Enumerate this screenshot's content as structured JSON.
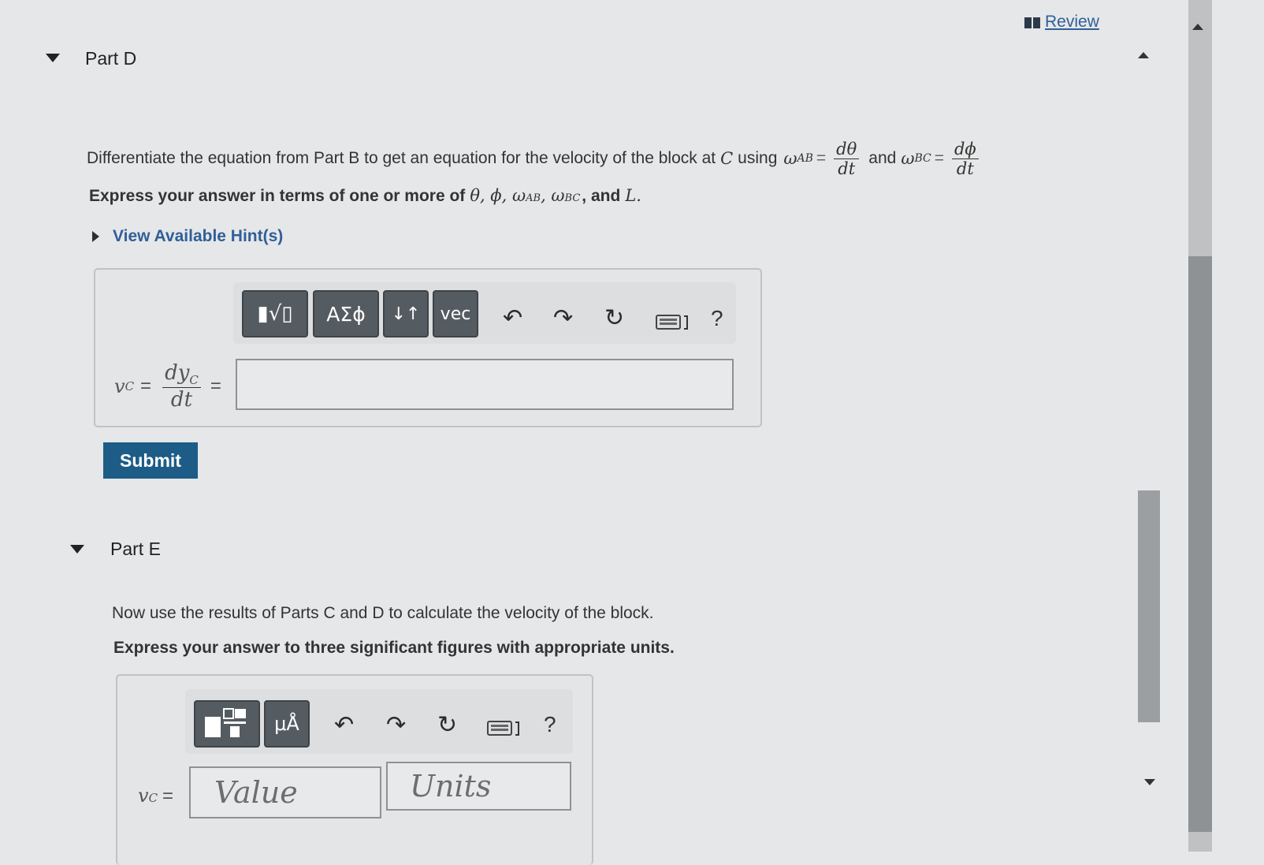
{
  "header": {
    "review_label": "Review"
  },
  "part_d": {
    "title": "Part D",
    "question_text": "Differentiate the equation from Part B to get an equation for the velocity of the block at",
    "point_c": "C",
    "using": "using",
    "omega_ab": "ω",
    "ab_sub": "AB",
    "equals": "=",
    "dtheta": "dθ",
    "dt": "dt",
    "and": "and",
    "omega_bc": "ω",
    "bc_sub": "BC",
    "dphi": "dϕ",
    "instruction_text": "Express your answer in terms of one or more of",
    "vars": "θ, ϕ, ω",
    "vars_ab": "AB",
    "vars_comma": ", ω",
    "vars_bc": "BC",
    "vars_and": ", and",
    "vars_l": "L.",
    "hint_label": "View Available Hint(s)",
    "toolbar": {
      "templates_label": "▮√▯",
      "greek_label": "ΑΣϕ",
      "arrows_label": "↓↑",
      "vec_label": "vec",
      "help_label": "?"
    },
    "lhs_v": "v",
    "lhs_c": "C",
    "lhs_eq": "=",
    "lhs_num": "dy",
    "lhs_num_sub": "C",
    "lhs_den": "dt",
    "rhs_eq": "=",
    "answer_value": "",
    "submit_label": "Submit"
  },
  "part_e": {
    "title": "Part E",
    "question_text": "Now use the results of Parts C and D to calculate the velocity of the block.",
    "instruction_text": "Express your answer to three significant figures with appropriate units.",
    "toolbar": {
      "units_label": "μÅ",
      "help_label": "?"
    },
    "lhs_v": "v",
    "lhs_c": "C",
    "lhs_eq": "=",
    "value_placeholder": "Value",
    "units_placeholder": "Units"
  }
}
